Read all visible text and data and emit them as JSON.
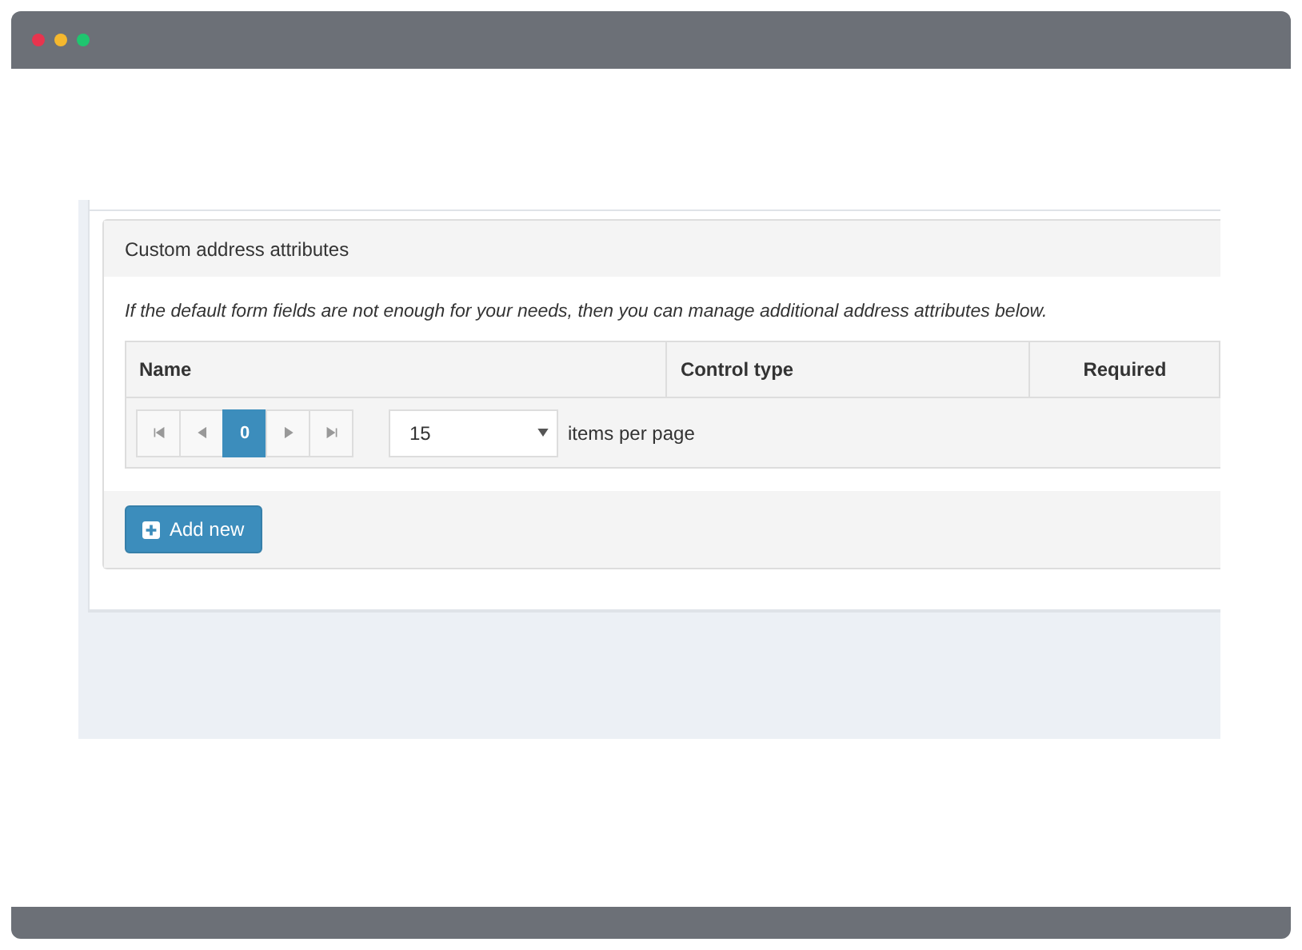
{
  "window": {
    "controls": [
      {
        "color": "#e8344e"
      },
      {
        "color": "#f5b82e"
      },
      {
        "color": "#1fc66f"
      }
    ]
  },
  "card": {
    "title": "Custom address attributes",
    "description": "If the default form fields are not enough for your needs, then you can manage additional address attributes below.",
    "table": {
      "columns": [
        {
          "label": "Name"
        },
        {
          "label": "Control type"
        },
        {
          "label": "Required"
        }
      ]
    },
    "pager": {
      "buttons": [
        {
          "kind": "first",
          "selected": false
        },
        {
          "kind": "prev",
          "selected": false
        },
        {
          "kind": "page",
          "label": "0",
          "selected": true
        },
        {
          "kind": "next",
          "selected": false
        },
        {
          "kind": "last",
          "selected": false
        }
      ],
      "page_size": "15",
      "page_size_label": "items per page"
    },
    "add_button": "Add new"
  }
}
